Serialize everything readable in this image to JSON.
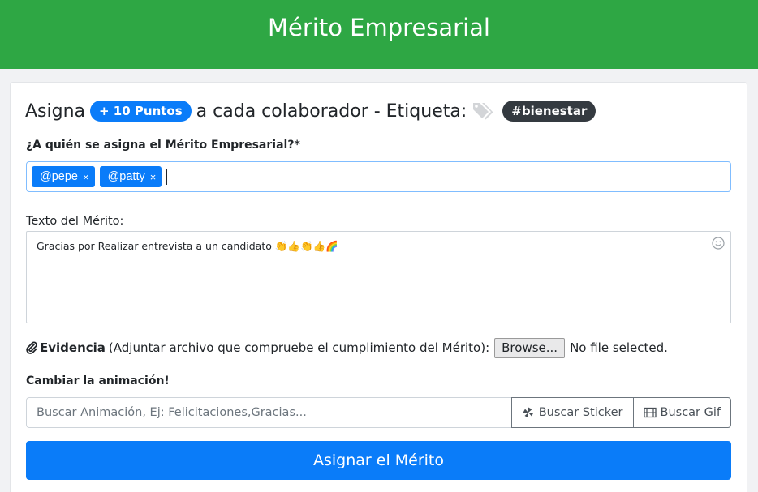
{
  "header": {
    "title": "Mérito Empresarial"
  },
  "heading": {
    "prefix": "Asigna",
    "points_badge": "+ 10 Puntos",
    "middle": "a cada colaborador - Etiqueta:",
    "tag_badge": "#bienestar"
  },
  "recipients": {
    "label": "¿A quién se asigna el Mérito Empresarial?*",
    "chips": [
      {
        "label": "@pepe",
        "remove": "×"
      },
      {
        "label": "@patty",
        "remove": "×"
      }
    ]
  },
  "merit_text": {
    "label": "Texto del Mérito:",
    "value": "Gracias por Realizar entrevista a un candidato 👏👍👏👍🌈"
  },
  "evidence": {
    "label_bold": "Evidencia",
    "label_rest": "(Adjuntar archivo que compruebe el cumplimiento del Mérito):",
    "browse_label": "Browse...",
    "file_status": "No file selected."
  },
  "animation": {
    "label": "Cambiar la animación!",
    "search_placeholder": "Buscar Animación, Ej: Felicitaciones,Gracias...",
    "sticker_button": "Buscar Sticker",
    "gif_button": "Buscar Gif"
  },
  "submit": {
    "label": "Asignar el Mérito"
  },
  "icons": {
    "tag": "tag-icon",
    "paperclip": "paperclip-icon",
    "sticker": "pinwheel-icon",
    "gif": "film-icon",
    "emoji": "smiley-icon"
  },
  "colors": {
    "header_green": "#2ea744",
    "primary_blue": "#0a7cf9",
    "dark_badge": "#343a40"
  }
}
